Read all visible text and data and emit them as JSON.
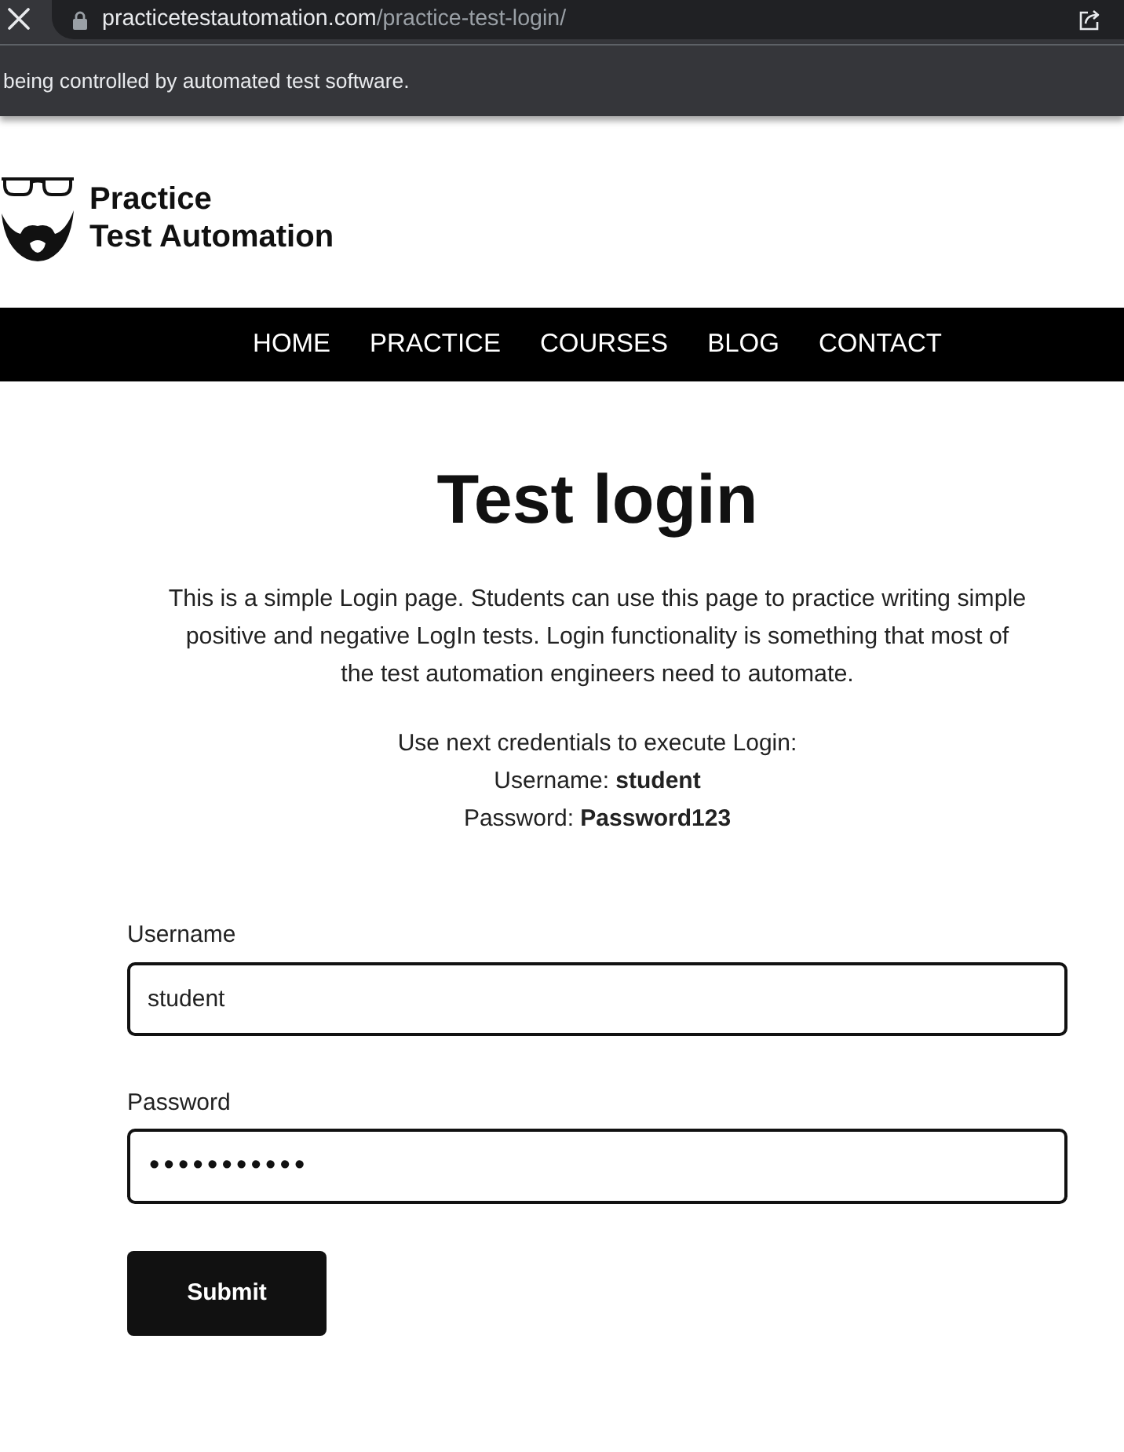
{
  "browser": {
    "url_host": "practicetestautomation.com",
    "url_path": "/practice-test-login/",
    "infobar_text": "being controlled by automated test software."
  },
  "logo": {
    "lines": [
      "Practice",
      "Test Automation"
    ]
  },
  "nav": {
    "items": [
      "HOME",
      "PRACTICE",
      "COURSES",
      "BLOG",
      "CONTACT"
    ]
  },
  "page": {
    "title": "Test login",
    "intro": "This is a simple Login page. Students can use this page to practice writing simple positive and negative LogIn tests. Login functionality is something that most of the test automation engineers need to automate.",
    "credentials": [
      "Use next credentials to execute Login:",
      "Username: **student**",
      "Password: **Password123**"
    ]
  },
  "form": {
    "fields": [
      {
        "kind": "text",
        "label": "Username",
        "value": "student"
      },
      {
        "kind": "password",
        "label": "Password",
        "value": "•••••••••••"
      }
    ],
    "submit": "Submit"
  }
}
